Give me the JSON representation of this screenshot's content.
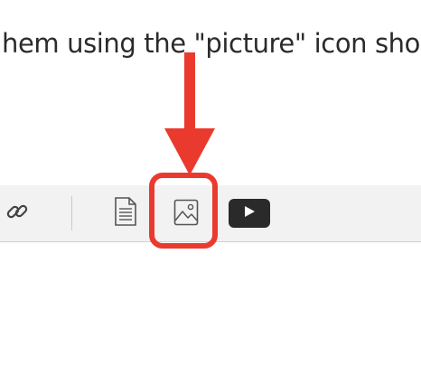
{
  "instruction": {
    "text": "hem using the \"picture\" icon sho"
  },
  "toolbar": {
    "items": [
      {
        "name": "link",
        "icon": "link-icon"
      },
      {
        "name": "document",
        "icon": "document-icon"
      },
      {
        "name": "picture",
        "icon": "picture-icon",
        "highlighted": true
      },
      {
        "name": "video",
        "icon": "play-icon"
      }
    ]
  },
  "annotation": {
    "color": "#ea3a2e",
    "arrow_target": "picture"
  },
  "colors": {
    "toolbar_bg": "#f2f2f2",
    "icon": "#555555",
    "video_bg": "#2a2a2a",
    "highlight": "#ea3a2e"
  }
}
